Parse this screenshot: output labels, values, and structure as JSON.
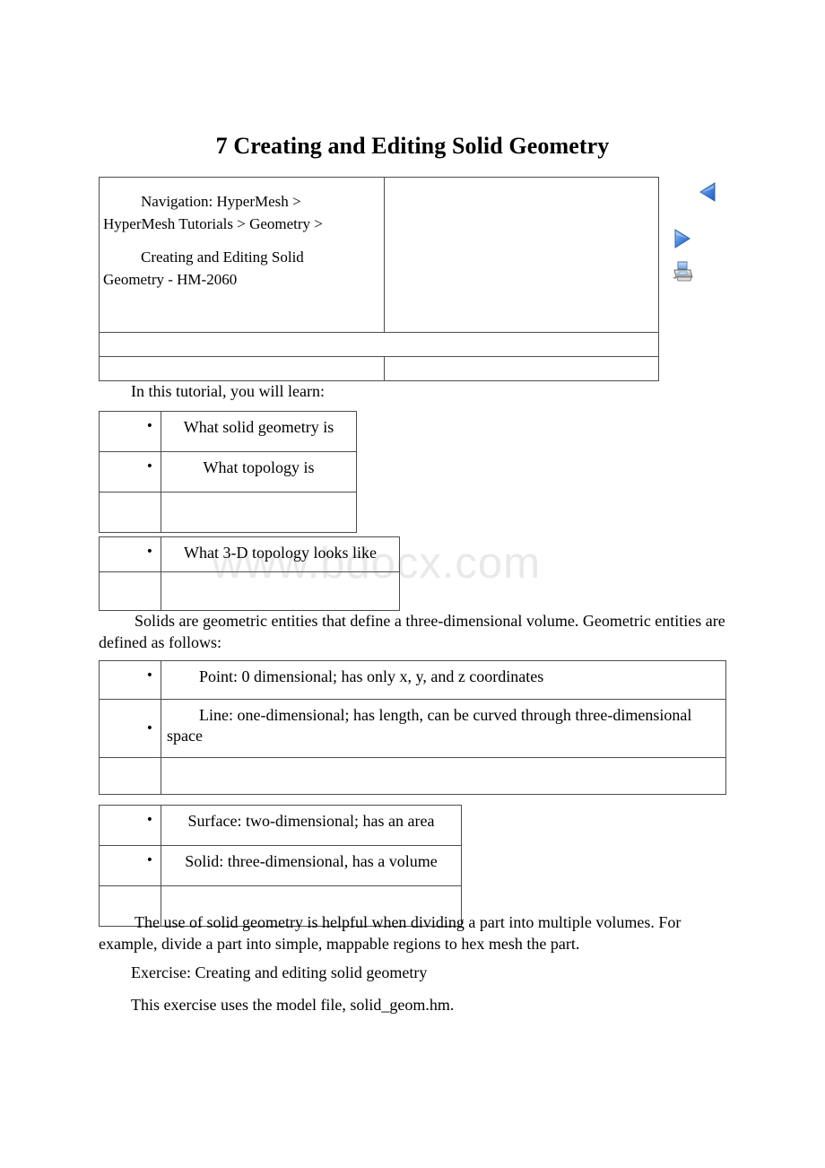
{
  "document": {
    "title": "7 Creating and Editing Solid Geometry",
    "watermark": "www.bdocx.com"
  },
  "navigation": {
    "line1": "Navigation:  HyperMesh >",
    "line2": "HyperMesh Tutorials > Geometry >",
    "line3": "Creating and Editing Solid",
    "line4": "Geometry - HM-2060",
    "icons": {
      "prev": "previous-arrow-icon",
      "next": "next-arrow-icon",
      "print": "print-icon"
    },
    "accent_color": "#3a78d8"
  },
  "intro": {
    "text": "In this tutorial, you will learn:"
  },
  "learn_list": {
    "bullet": "•",
    "items": [
      "What solid geometry is",
      "What topology is"
    ]
  },
  "topology_list": {
    "bullet": "•",
    "items": [
      "What 3-D topology looks like"
    ]
  },
  "solids_paragraph": {
    "text": "Solids are geometric entities that define a three-dimensional volume. Geometric entities are defined as follows:"
  },
  "entity_list_a": {
    "bullet": "•",
    "items": [
      "Point: 0 dimensional; has only x, y, and z coordinates",
      "Line: one-dimensional; has length, can be curved through three-dimensional space"
    ]
  },
  "entity_list_b": {
    "bullet": "•",
    "items": [
      "Surface: two-dimensional; has an area",
      "Solid: three-dimensional, has a volume"
    ]
  },
  "closing": {
    "usage": "The use of solid geometry is helpful when dividing a part into multiple volumes. For example, divide a part into simple, mappable regions to hex mesh the part.",
    "exercise": "Exercise: Creating and editing solid geometry",
    "file_note": "This exercise uses the model file, solid_geom.hm."
  }
}
